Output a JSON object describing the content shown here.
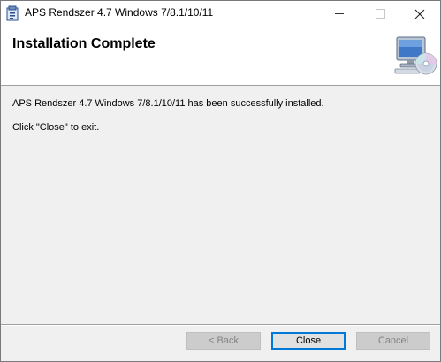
{
  "window": {
    "title": "APS Rendszer 4.7 Windows 7/8.1/10/11",
    "controls": {
      "minimize_icon": "minimize-icon",
      "maximize_icon": "maximize-icon",
      "close_icon": "close-icon"
    }
  },
  "banner": {
    "title": "Installation Complete",
    "icon": "computer-cd-icon"
  },
  "content": {
    "line1": "APS Rendszer 4.7 Windows 7/8.1/10/11 has been successfully installed.",
    "line2": "Click \"Close\" to exit."
  },
  "buttons": {
    "back": "< Back",
    "close": "Close",
    "cancel": "Cancel"
  },
  "colors": {
    "accent": "#0078d7",
    "dialog_bg": "#f0f0f0",
    "disabled_text": "#838383"
  }
}
